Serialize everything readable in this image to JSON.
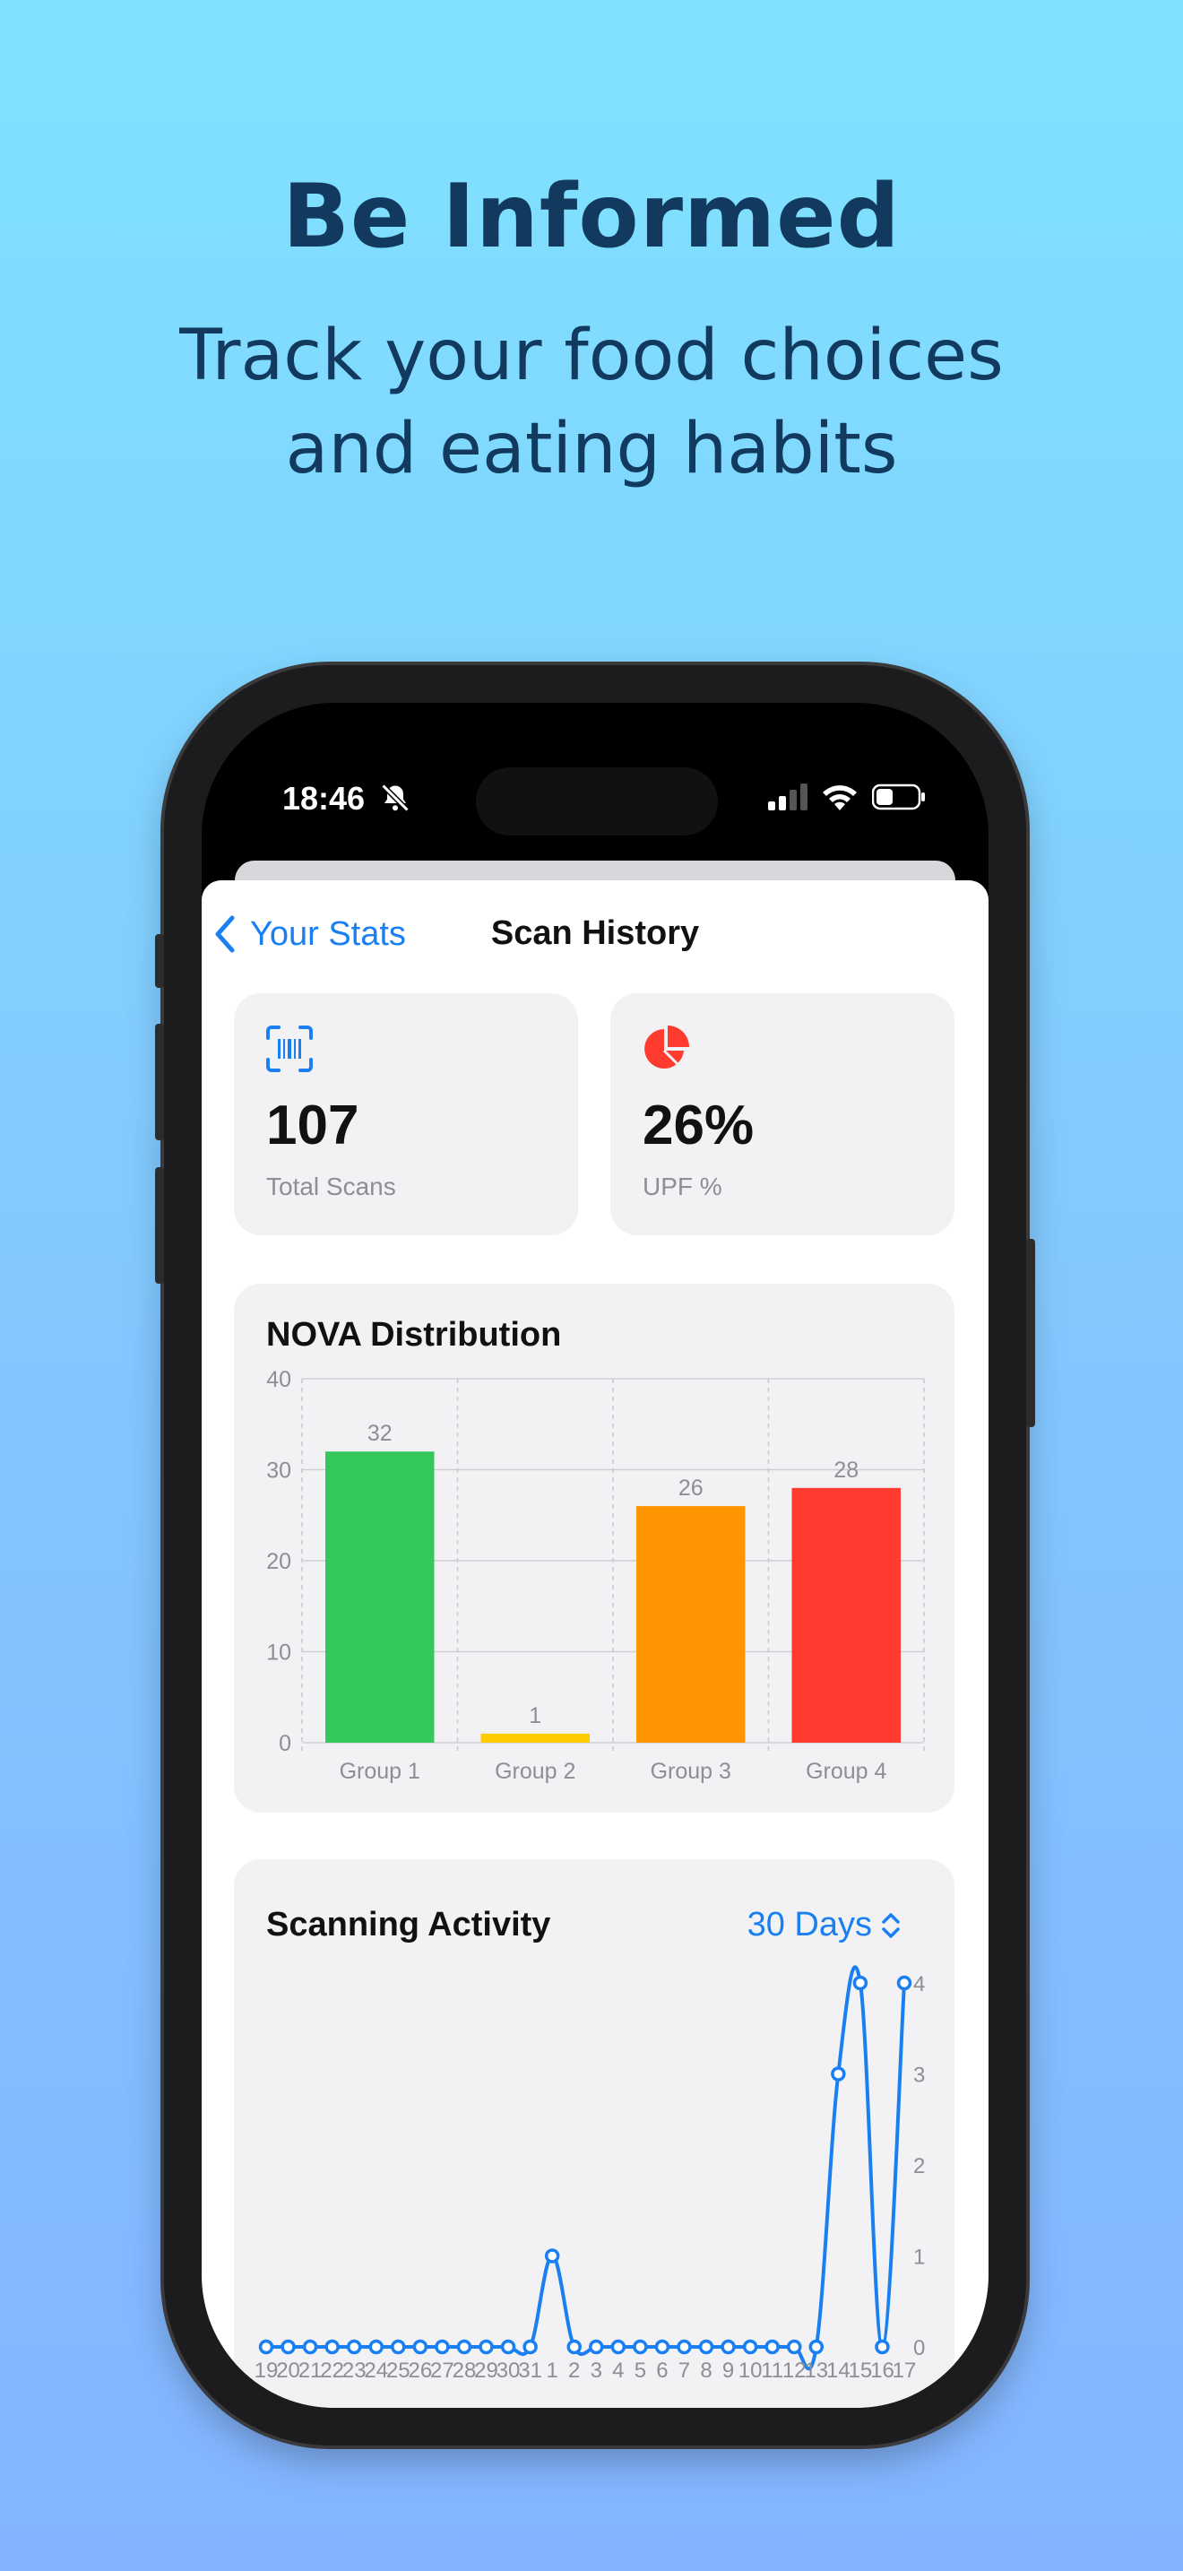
{
  "promo": {
    "headline": "Be Informed",
    "subline": "Track your food choices and eating habits"
  },
  "status_bar": {
    "time": "18:46",
    "icons": [
      "bell-slash-icon",
      "cellular-signal-icon",
      "wifi-icon",
      "battery-icon"
    ]
  },
  "nav": {
    "back_label": "Your Stats",
    "title": "Scan History"
  },
  "stats": [
    {
      "icon": "barcode-scan-icon",
      "value": "107",
      "label": "Total Scans",
      "accent": "#1a7ff0"
    },
    {
      "icon": "pie-chart-icon",
      "value": "26%",
      "label": "UPF %",
      "accent": "#ff3b30"
    }
  ],
  "nova": {
    "title": "NOVA Distribution"
  },
  "activity": {
    "title": "Scanning Activity",
    "range_label": "30 Days"
  },
  "chart_data": [
    {
      "type": "bar",
      "title": "NOVA Distribution",
      "categories": [
        "Group 1",
        "Group 2",
        "Group 3",
        "Group 4"
      ],
      "values": [
        32,
        1,
        26,
        28
      ],
      "colors": [
        "#34c759",
        "#ffcc00",
        "#ff9500",
        "#ff3b30"
      ],
      "ylim": [
        0,
        40
      ],
      "yticks": [
        0,
        10,
        20,
        30,
        40
      ],
      "grid": true,
      "data_labels": true
    },
    {
      "type": "line",
      "title": "Scanning Activity",
      "x": [
        "19",
        "20",
        "21",
        "22",
        "23",
        "24",
        "25",
        "26",
        "27",
        "28",
        "29",
        "30",
        "31",
        "1",
        "2",
        "3",
        "4",
        "5",
        "6",
        "7",
        "8",
        "9",
        "10",
        "11",
        "12",
        "13",
        "14",
        "15",
        "16",
        "17"
      ],
      "values": [
        0,
        0,
        0,
        0,
        0,
        0,
        0,
        0,
        0,
        0,
        0,
        0,
        0,
        1,
        0,
        0,
        0,
        0,
        0,
        0,
        0,
        0,
        0,
        0,
        0,
        0,
        3,
        4,
        0,
        4
      ],
      "color": "#1a7ff0",
      "ylim": [
        0,
        4
      ],
      "yticks": [
        0,
        1,
        2,
        3,
        4
      ],
      "y_axis_position": "right"
    }
  ]
}
